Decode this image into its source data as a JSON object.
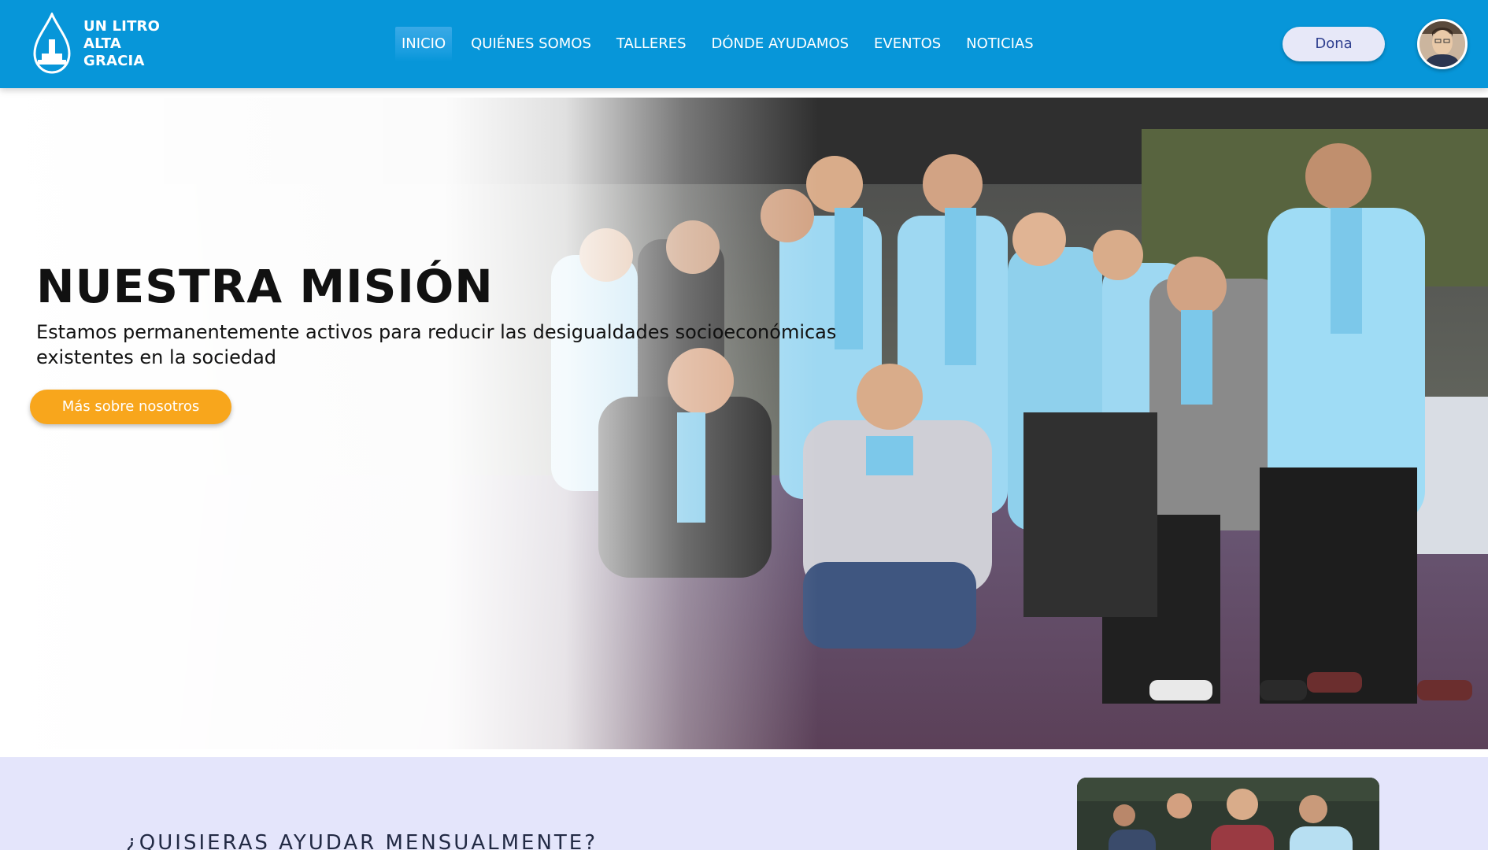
{
  "header": {
    "logo": {
      "line1": "UN LITRO",
      "line2": "ALTA GRACIA"
    },
    "nav": [
      {
        "label": "INICIO",
        "active": true
      },
      {
        "label": "QUIÉNES SOMOS",
        "active": false
      },
      {
        "label": "TALLERES",
        "active": false
      },
      {
        "label": "DÓNDE AYUDAMOS",
        "active": false
      },
      {
        "label": "EVENTOS",
        "active": false
      },
      {
        "label": "NOTICIAS",
        "active": false
      }
    ],
    "donate_label": "Dona",
    "avatar_icon": "user-avatar"
  },
  "hero": {
    "title": "NUESTRA MISIÓN",
    "subtitle": "Estamos permanentemente activos para reducir las desigualdades socioeconómicas existentes en la sociedad",
    "cta_label": "Más sobre nosotros",
    "image_icon": "volunteers-group-photo"
  },
  "monthly": {
    "title": "¿QUISIERAS AYUDAR MENSUALMENTE?",
    "image_icon": "children-photo"
  },
  "colors": {
    "nav_bg": "#0796d9",
    "cta_orange": "#f8a61c",
    "donate_bg": "#e7e8f8",
    "section_bg": "#e4e5fb",
    "scarf_blue": "#8fd3f0"
  }
}
